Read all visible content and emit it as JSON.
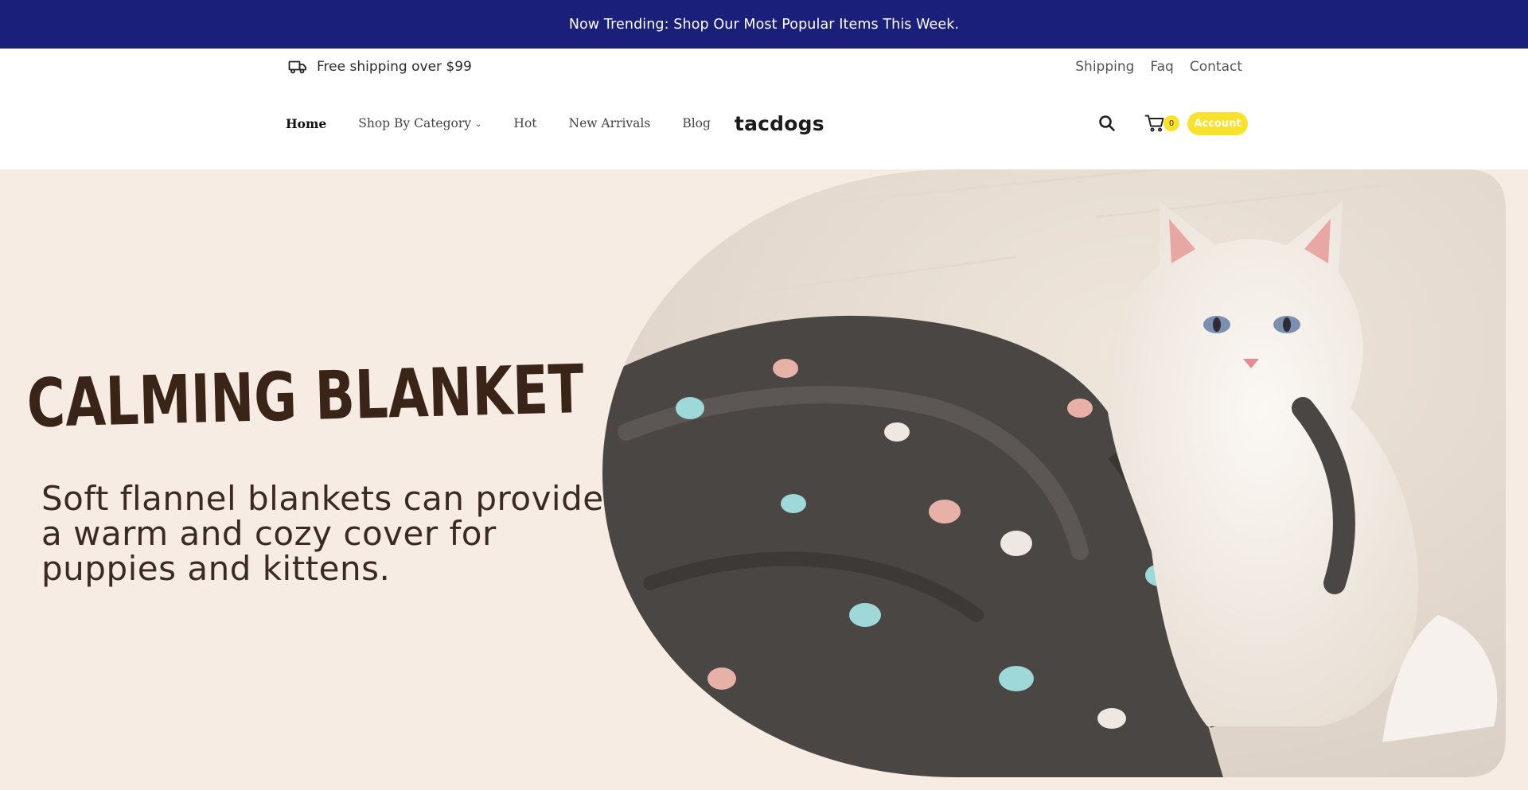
{
  "announcement": {
    "text": "Now Trending: Shop Our Most Popular Items This Week."
  },
  "topbar": {
    "shipping_text": "Free shipping over $99",
    "shipping_icon": "truck-icon",
    "links": [
      "Shipping",
      "Faq",
      "Contact"
    ]
  },
  "nav": {
    "items": [
      {
        "label": "Home",
        "active": true
      },
      {
        "label": "Shop By Category",
        "dropdown": true
      },
      {
        "label": "Hot"
      },
      {
        "label": "New Arrivals"
      },
      {
        "label": "Blog"
      }
    ],
    "logo": "tacdogs",
    "search_icon": "search-icon",
    "cart_icon": "cart-icon",
    "cart_count": "0",
    "account_label": "Account"
  },
  "hero": {
    "title": "CALMING BLANKET",
    "subtitle": "Soft flannel blankets can provide a warm and cozy cover for puppies and kittens."
  },
  "colors": {
    "announcement_bg": "#1a1f7a",
    "accent_yellow": "#f8e22c",
    "hero_bg": "#f6ece4",
    "hero_title": "#3a2418"
  }
}
